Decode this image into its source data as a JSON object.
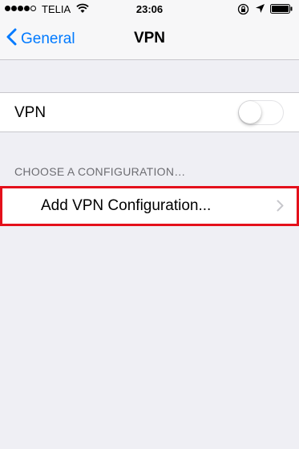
{
  "status_bar": {
    "carrier": "TELIA",
    "time": "23:06",
    "signal_icon": "signal-dots",
    "wifi_icon": "wifi-icon",
    "lock_icon": "rotation-lock-icon",
    "location_icon": "location-arrow-icon",
    "battery_icon": "battery-icon"
  },
  "nav": {
    "back_label": "General",
    "title": "VPN"
  },
  "vpn": {
    "label": "VPN",
    "enabled": false
  },
  "configurations": {
    "header": "CHOOSE A CONFIGURATION…",
    "add_label": "Add VPN Configuration...",
    "highlight_color": "#e4101b"
  },
  "colors": {
    "accent": "#007aff",
    "background": "#efeff4"
  }
}
